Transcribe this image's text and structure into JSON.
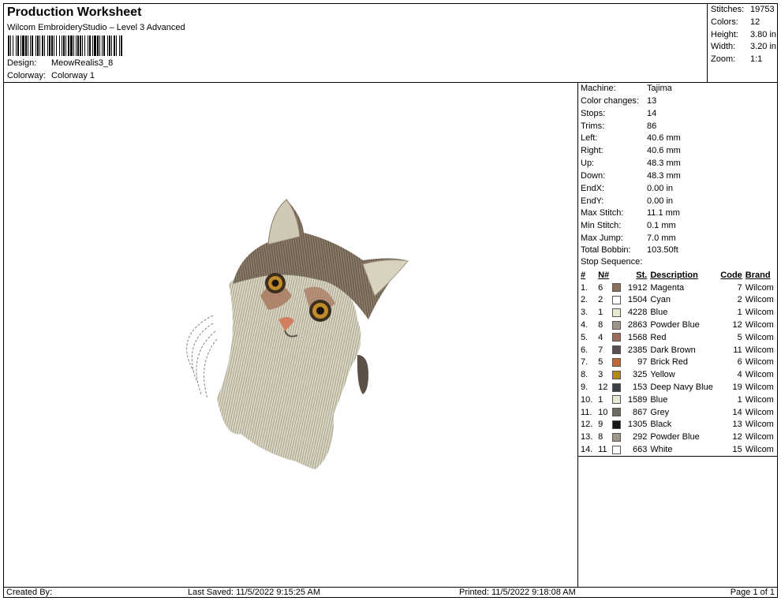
{
  "header": {
    "title": "Production Worksheet",
    "subtitle": "Wilcom EmbroideryStudio – Level 3 Advanced",
    "design_label": "Design:",
    "design_value": "MeowRealis3_8",
    "colorway_label": "Colorway:",
    "colorway_value": "Colorway 1"
  },
  "summary": [
    {
      "label": "Stitches:",
      "value": "19753"
    },
    {
      "label": "Colors:",
      "value": "12"
    },
    {
      "label": "Height:",
      "value": "3.80 in"
    },
    {
      "label": "Width:",
      "value": "3.20 in"
    },
    {
      "label": "Zoom:",
      "value": "1:1"
    }
  ],
  "properties": [
    {
      "label": "Machine:",
      "value": "Tajima"
    },
    {
      "label": "Color changes:",
      "value": "13"
    },
    {
      "label": "Stops:",
      "value": "14"
    },
    {
      "label": "Trims:",
      "value": "86"
    },
    {
      "label": "Left:",
      "value": "40.6 mm"
    },
    {
      "label": "Right:",
      "value": "40.6 mm"
    },
    {
      "label": "Up:",
      "value": "48.3 mm"
    },
    {
      "label": "Down:",
      "value": "48.3 mm"
    },
    {
      "label": "EndX:",
      "value": "0.00 in"
    },
    {
      "label": "EndY:",
      "value": "0.00 in"
    },
    {
      "label": "Max Stitch:",
      "value": "11.1 mm"
    },
    {
      "label": "Min Stitch:",
      "value": "0.1 mm"
    },
    {
      "label": "Max Jump:",
      "value": "7.0 mm"
    },
    {
      "label": "Total Bobbin:",
      "value": "103.50ft"
    }
  ],
  "stop_sequence": {
    "label": "Stop Sequence:",
    "headers": {
      "num": "#",
      "n": "N#",
      "st": "St.",
      "desc": "Description",
      "code": "Code",
      "brand": "Brand"
    },
    "rows": [
      {
        "num": "1.",
        "n": "6",
        "color": "#8c6f5c",
        "st": "1912",
        "desc": "Magenta",
        "code": "7",
        "brand": "Wilcom"
      },
      {
        "num": "2.",
        "n": "2",
        "color": "#ffffff",
        "st": "1504",
        "desc": "Cyan",
        "code": "2",
        "brand": "Wilcom"
      },
      {
        "num": "3.",
        "n": "1",
        "color": "#e9e6d2",
        "st": "4228",
        "desc": "Blue",
        "code": "1",
        "brand": "Wilcom"
      },
      {
        "num": "4.",
        "n": "8",
        "color": "#9f9589",
        "st": "2863",
        "desc": "Powder Blue",
        "code": "12",
        "brand": "Wilcom"
      },
      {
        "num": "5.",
        "n": "4",
        "color": "#9e6c58",
        "st": "1568",
        "desc": "Red",
        "code": "5",
        "brand": "Wilcom"
      },
      {
        "num": "6.",
        "n": "7",
        "color": "#5a4e52",
        "st": "2385",
        "desc": "Dark Brown",
        "code": "11",
        "brand": "Wilcom"
      },
      {
        "num": "7.",
        "n": "5",
        "color": "#c0673a",
        "st": "97",
        "desc": "Brick Red",
        "code": "6",
        "brand": "Wilcom"
      },
      {
        "num": "8.",
        "n": "3",
        "color": "#b08a12",
        "st": "325",
        "desc": "Yellow",
        "code": "4",
        "brand": "Wilcom"
      },
      {
        "num": "9.",
        "n": "12",
        "color": "#3c3f4a",
        "st": "153",
        "desc": "Deep Navy Blue",
        "code": "19",
        "brand": "Wilcom"
      },
      {
        "num": "10.",
        "n": "1",
        "color": "#e9e6d2",
        "st": "1589",
        "desc": "Blue",
        "code": "1",
        "brand": "Wilcom"
      },
      {
        "num": "11.",
        "n": "10",
        "color": "#6e6b63",
        "st": "867",
        "desc": "Grey",
        "code": "14",
        "brand": "Wilcom"
      },
      {
        "num": "12.",
        "n": "9",
        "color": "#151515",
        "st": "1305",
        "desc": "Black",
        "code": "13",
        "brand": "Wilcom"
      },
      {
        "num": "13.",
        "n": "8",
        "color": "#9f9589",
        "st": "292",
        "desc": "Powder Blue",
        "code": "12",
        "brand": "Wilcom"
      },
      {
        "num": "14.",
        "n": "11",
        "color": "#ffffff",
        "st": "663",
        "desc": "White",
        "code": "15",
        "brand": "Wilcom"
      }
    ]
  },
  "footer": {
    "created": "Created By:",
    "saved": "Last Saved: 11/5/2022 9:15:25 AM",
    "printed": "Printed: 11/5/2022 9:18:08 AM",
    "page": "Page 1 of 1"
  },
  "design_preview": {
    "subject": "cat-embroidery"
  }
}
